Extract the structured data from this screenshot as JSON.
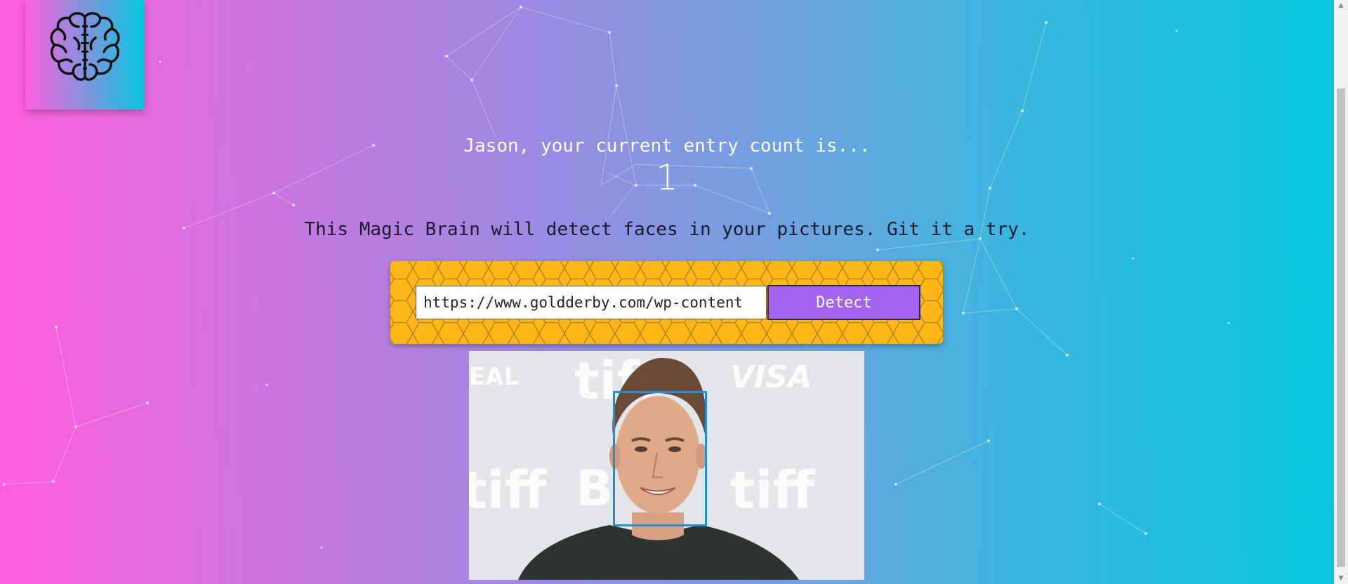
{
  "logo": {
    "icon": "brain-icon"
  },
  "rank": {
    "message": "Jason, your current entry count is...",
    "count": "1"
  },
  "tagline": "This Magic Brain will detect faces in your pictures. Git it a try.",
  "form": {
    "url_value": "https://www.goldderby.com/wp-content",
    "detect_label": "Detect"
  },
  "image": {
    "backdrop_words": [
      "tiff",
      "VISA",
      "EAL",
      "tiff",
      "B",
      "tiff"
    ],
    "face_box": "face-bounding-box"
  },
  "colors": {
    "gradient_start": "#ff5edf",
    "gradient_end": "#04c8de",
    "form_background": "#fdb817",
    "detect_button": "#a463f2",
    "bounding_box": "#1d8fe0"
  }
}
